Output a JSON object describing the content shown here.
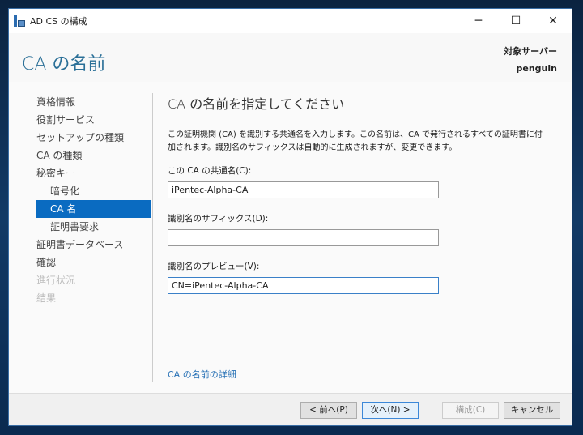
{
  "window": {
    "title": "AD CS の構成",
    "minimize": "─",
    "maximize": "☐",
    "close": "✕"
  },
  "header": {
    "title": "CA の名前",
    "server_label": "対象サーバー",
    "server_name": "penguin"
  },
  "sidebar": {
    "items": [
      {
        "label": "資格情報",
        "state": "normal"
      },
      {
        "label": "役割サービス",
        "state": "normal"
      },
      {
        "label": "セットアップの種類",
        "state": "normal"
      },
      {
        "label": "CA の種類",
        "state": "normal"
      },
      {
        "label": "秘密キー",
        "state": "normal"
      },
      {
        "label": "暗号化",
        "state": "sub"
      },
      {
        "label": "CA 名",
        "state": "selected"
      },
      {
        "label": "証明書要求",
        "state": "sub"
      },
      {
        "label": "証明書データベース",
        "state": "normal"
      },
      {
        "label": "確認",
        "state": "normal"
      },
      {
        "label": "進行状況",
        "state": "disabled"
      },
      {
        "label": "結果",
        "state": "disabled"
      }
    ]
  },
  "main": {
    "heading": "CA の名前を指定してください",
    "description": "この証明機関 (CA) を識別する共通名を入力します。この名前は、CA で発行されるすべての証明書に付加されます。識別名のサフィックスは自動的に生成されますが、変更できます。",
    "common_name_label": "この CA の共通名(C):",
    "common_name_value": "iPentec-Alpha-CA",
    "suffix_label": "識別名のサフィックス(D):",
    "suffix_value": "",
    "preview_label": "識別名のプレビュー(V):",
    "preview_value": "CN=iPentec-Alpha-CA",
    "more_link": "CA の名前の詳細"
  },
  "footer": {
    "prev": "< 前へ(P)",
    "next": "次へ(N) >",
    "configure": "構成(C)",
    "cancel": "キャンセル"
  }
}
